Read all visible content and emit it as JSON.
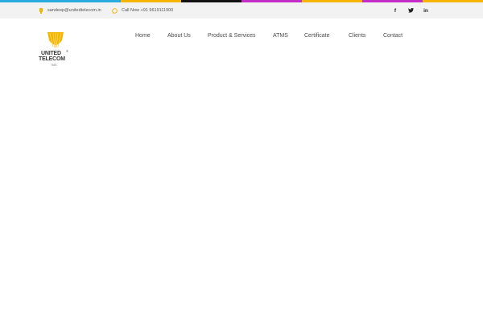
{
  "top_strip": {
    "colors": [
      "#29abe2",
      "#29abe2",
      "#f7b500",
      "#111111",
      "#c22ec7",
      "#f7b500",
      "#c22ec7",
      "#f7b500"
    ]
  },
  "topbar": {
    "email": "sandeep@unitedtelecom.in",
    "phone": "Call Now +91 9619111900",
    "icon_color": "#f0b400",
    "social": [
      {
        "icon": "facebook-icon",
        "glyph": "f"
      },
      {
        "icon": "twitter-icon",
        "glyph": "❧"
      },
      {
        "icon": "linkedin-icon",
        "glyph": "in"
      }
    ]
  },
  "logo": {
    "line1": "UNITED",
    "line2": "TELECOM",
    "reg": "®",
    "small": "TMS",
    "mark_color": "#f2b600"
  },
  "nav": {
    "items": [
      "Home",
      "About Us",
      "Product & Services",
      "ATMS",
      "Certificate",
      "Clients",
      "Contact"
    ]
  }
}
